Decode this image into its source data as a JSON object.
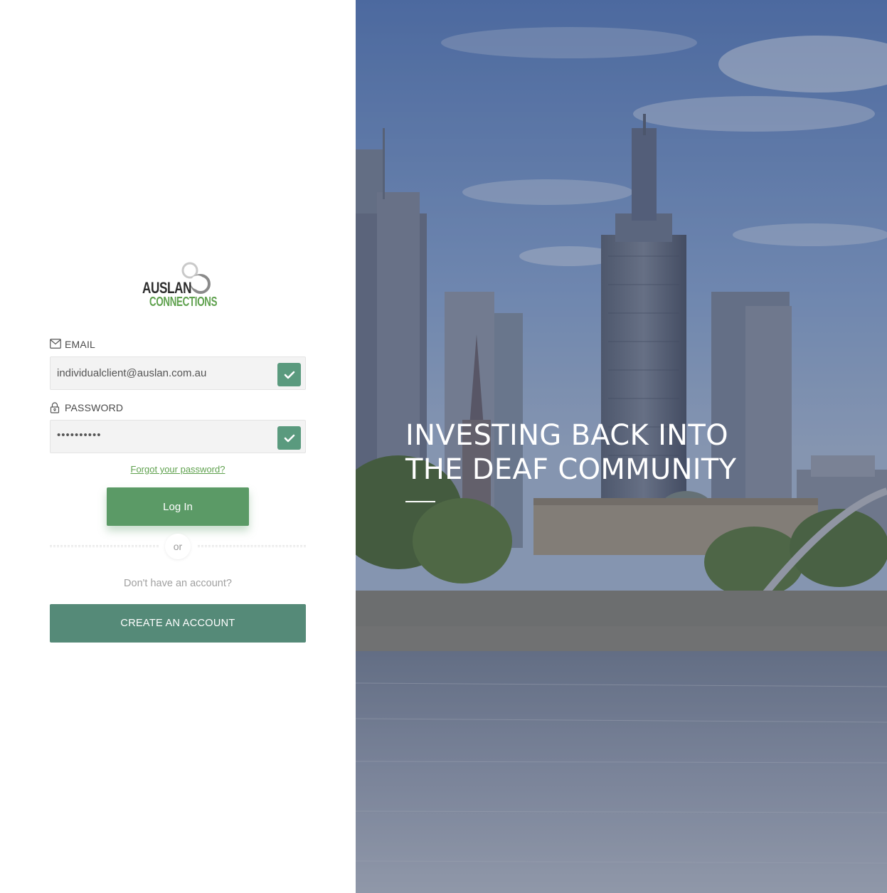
{
  "brand": {
    "line1": "AUSLAN",
    "line2": "CONNECTIONS",
    "color_dark": "#2d2d2d",
    "color_green": "#5fa14e"
  },
  "form": {
    "email": {
      "label": "EMAIL",
      "icon": "envelope-icon",
      "value": "individualclient@auslan.com.au",
      "valid": true
    },
    "password": {
      "label": "PASSWORD",
      "icon": "lock-icon",
      "value": "••••••••••",
      "valid": true
    },
    "forgot_link": "Forgot your password?",
    "login_label": "Log In",
    "divider_text": "or",
    "no_account_text": "Don't have an account?",
    "create_account_label": "CREATE AN ACCOUNT"
  },
  "hero": {
    "heading_line1": "INVESTING BACK INTO",
    "heading_line2": "THE DEAF COMMUNITY"
  },
  "colors": {
    "login_button": "#5b9a66",
    "create_button": "#558a78",
    "check_badge": "#5a9a7e",
    "link": "#5fa14e"
  }
}
